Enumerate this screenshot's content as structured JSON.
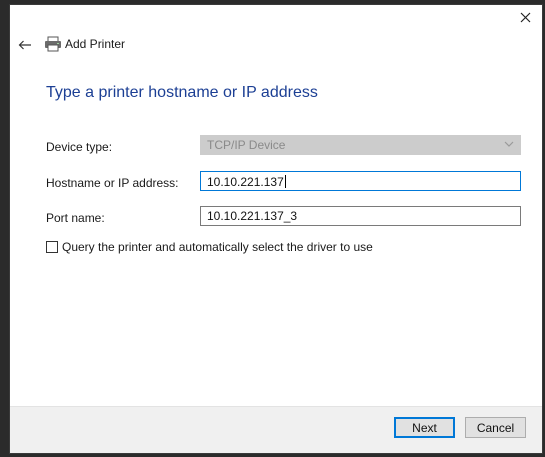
{
  "window": {
    "title": "Add Printer",
    "close_glyph": "✕",
    "back_glyph": "←"
  },
  "heading": "Type a printer hostname or IP address",
  "form": {
    "device_type_label": "Device type:",
    "device_type_value": "TCP/IP Device",
    "hostname_label": "Hostname or IP address:",
    "hostname_value": "10.10.221.137",
    "port_label": "Port name:",
    "port_value": "10.10.221.137_3",
    "query_label": "Query the printer and automatically select the driver to use",
    "query_checked": false
  },
  "buttons": {
    "next": "Next",
    "cancel": "Cancel"
  },
  "colors": {
    "heading": "#1c3f94",
    "focus_border": "#0078d7",
    "footer_bg": "#f0f0f0"
  },
  "icons": [
    "close-icon",
    "back-arrow-icon",
    "printer-icon",
    "chevron-down-icon"
  ]
}
